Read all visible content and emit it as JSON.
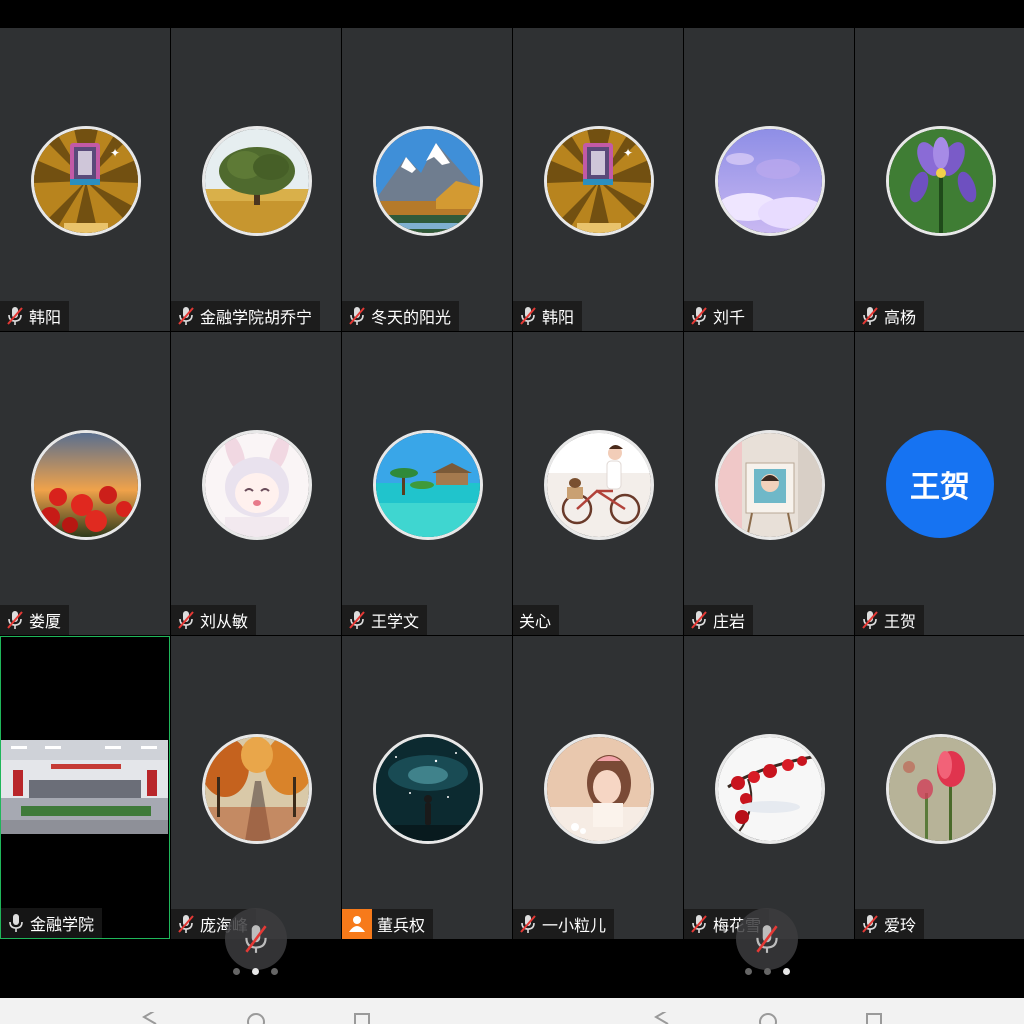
{
  "participants": [
    {
      "name": "韩阳",
      "mic": "muted",
      "avatar": "card-avatar"
    },
    {
      "name": "金融学院胡乔宁",
      "mic": "muted",
      "avatar": "tree-avatar"
    },
    {
      "name": "冬天的阳光",
      "mic": "muted",
      "avatar": "mountain-avatar"
    },
    {
      "name": "韩阳",
      "mic": "muted",
      "avatar": "card-avatar"
    },
    {
      "name": "刘千",
      "mic": "muted",
      "avatar": "purple-sky-avatar"
    },
    {
      "name": "高杨",
      "mic": "muted",
      "avatar": "iris-avatar"
    },
    {
      "name": "娄厦",
      "mic": "muted",
      "avatar": "poppy-avatar"
    },
    {
      "name": "刘从敏",
      "mic": "muted",
      "avatar": "anime-avatar"
    },
    {
      "name": "王学文",
      "mic": "muted",
      "avatar": "beach-avatar"
    },
    {
      "name": "关心",
      "mic": "none",
      "avatar": "bicycle-avatar"
    },
    {
      "name": "庄岩",
      "mic": "muted",
      "avatar": "portrait-avatar"
    },
    {
      "name": "王贺",
      "mic": "muted",
      "avatar": "text",
      "avatar_text": "王贺"
    },
    {
      "name": "金融学院",
      "mic": "on",
      "avatar": "video"
    },
    {
      "name": "庞海峰",
      "mic": "muted",
      "avatar": "autumn-avatar"
    },
    {
      "name": "董兵权",
      "mic": "person",
      "avatar": "galaxy-avatar"
    },
    {
      "name": "一小粒儿",
      "mic": "muted",
      "avatar": "girl-avatar"
    },
    {
      "name": "梅花雪",
      "mic": "muted",
      "avatar": "plum-avatar"
    },
    {
      "name": "爱玲",
      "mic": "muted",
      "avatar": "tulip-avatar"
    }
  ],
  "colors": {
    "tile_bg": "#2f3133",
    "active_border": "#1fb65a",
    "text_avatar_bg": "#1673f2",
    "muted_mic": "#e53935",
    "person_badge": "#f77a1a"
  },
  "pager": {
    "total_pages": 3,
    "current_page": 2
  }
}
